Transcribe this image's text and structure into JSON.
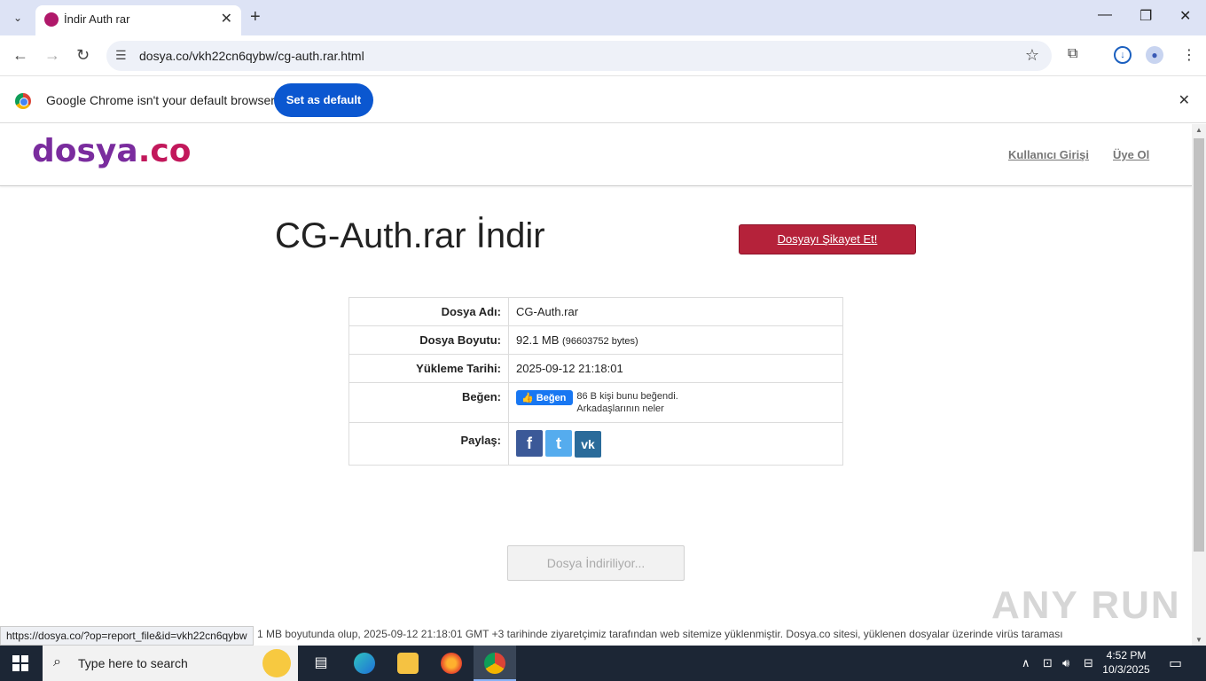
{
  "browser": {
    "tab_title": "İndir Auth rar",
    "url": "dosya.co/vkh22cn6qybw/cg-auth.rar.html",
    "infobar_text": "Google Chrome isn't your default browser",
    "set_default_label": "Set as default",
    "status_url": "https://dosya.co/?op=report_file&id=vkh22cn6qybw"
  },
  "site": {
    "logo_part1": "dosya",
    "logo_part2": ".co",
    "nav": {
      "login": "Kullanıcı Girişi",
      "register": "Üye Ol"
    },
    "page_title": "CG-Auth.rar İndir",
    "report_button": "Dosyayı Şikayet Et!",
    "table": {
      "name_label": "Dosya Adı:",
      "name_value": "CG-Auth.rar",
      "size_label": "Dosya Boyutu:",
      "size_value": "92.1 MB",
      "size_bytes": "(96603752 bytes)",
      "date_label": "Yükleme Tarihi:",
      "date_value": "2025-09-12 21:18:01",
      "like_label": "Beğen:",
      "like_button": "Beğen",
      "like_text_1": "86 B kişi bunu beğendi.",
      "like_text_2": "Arkadaşlarının neler",
      "share_label": "Paylaş:"
    },
    "download_button": "Dosya İndiriliyor...",
    "description": "1 MB boyutunda olup, 2025-09-12 21:18:01 GMT +3 tarihinde ziyaretçimiz tarafından web sitemize yüklenmiştir. Dosya.co sitesi, yüklenen dosyalar üzerinde virüs taraması",
    "watermark": "ANY RUN"
  },
  "taskbar": {
    "search_placeholder": "Type here to search",
    "time": "4:52 PM",
    "date": "10/3/2025"
  },
  "colors": {
    "report_red": "#b5223a",
    "chrome_blue": "#0b57d0",
    "facebook": "#3b5998",
    "twitter": "#55acee",
    "vk": "#2a6b9a"
  }
}
